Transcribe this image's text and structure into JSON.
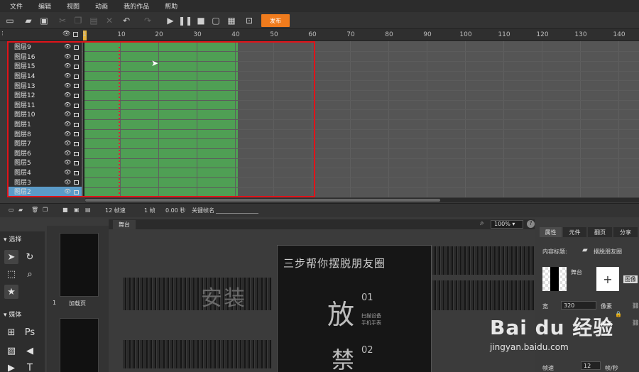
{
  "menu": [
    "文件",
    "编辑",
    "视图",
    "动画",
    "我的作品",
    "帮助"
  ],
  "toolbar": {
    "publish_label": "发布"
  },
  "timeline": {
    "ticks": [
      "1",
      "10",
      "20",
      "30",
      "40",
      "50",
      "60",
      "70",
      "80",
      "90",
      "100",
      "110",
      "120",
      "130",
      "140"
    ],
    "layers": [
      "图层9",
      "图层16",
      "图层15",
      "图层14",
      "图层13",
      "图层12",
      "图层11",
      "图层10",
      "图层1",
      "图层8",
      "图层7",
      "图层6",
      "图层5",
      "图层4",
      "图层3",
      "图层2"
    ],
    "selected_layer": "图层2",
    "status": {
      "fps": "12 帧速",
      "frame": "1 帧",
      "time": "0.00 秒",
      "keyframe_label": "关键帧名"
    }
  },
  "tools": {
    "select_section": "选择",
    "media_section": "媒体",
    "ps_label": "Ps"
  },
  "pages": [
    {
      "number": "1",
      "label": "加载页"
    }
  ],
  "stage": {
    "tab": "舞台",
    "zoom": "100%",
    "canvas_title": "三步帮你摆脱朋友圈",
    "canvas_big1": "放",
    "canvas_num1": "01",
    "canvas_small1": "扫描设备",
    "canvas_small2": "手机手表",
    "canvas_big2": "禁",
    "canvas_num2": "02",
    "bg_text": "安装"
  },
  "right": {
    "tabs": [
      "属性",
      "元件",
      "翻页",
      "分享"
    ],
    "content_title_label": "内容标题:",
    "content_title_value": "摆脱朋友圈",
    "stage_label": "舞台",
    "image_label": "图像",
    "width_label": "宽",
    "width_value": "320",
    "unit1": "像素",
    "unit2": "像素",
    "fps_label": "帧速",
    "fps_value": "12",
    "fps_unit": "帧/秒"
  },
  "watermark": {
    "brand": "Bai du 经验",
    "url": "jingyan.baidu.com"
  },
  "colors": {
    "accent": "#ef7b1d",
    "timeline_green": "#4f9f54",
    "selection_blue": "#5b9bc8",
    "highlight_red": "#e0141a"
  }
}
